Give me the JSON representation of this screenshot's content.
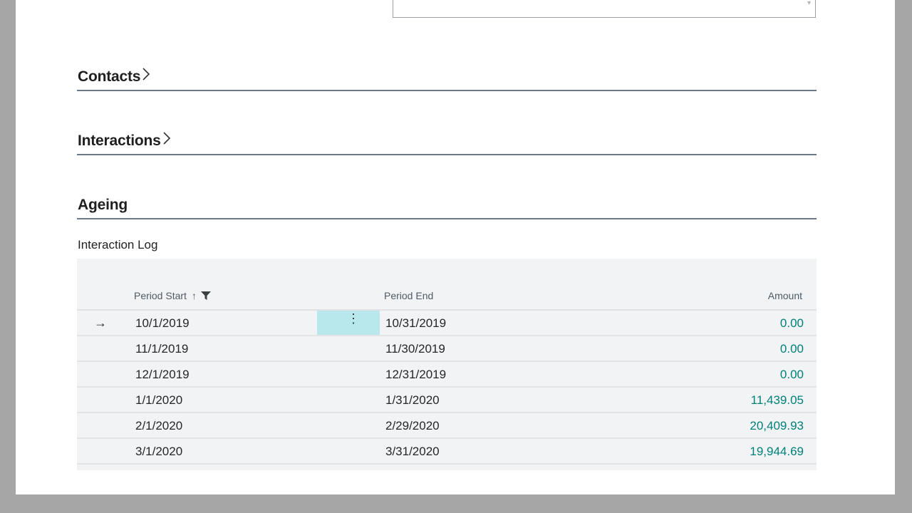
{
  "sections": [
    {
      "title": "Contacts",
      "collapsed": true
    },
    {
      "title": "Interactions",
      "collapsed": true
    },
    {
      "title": "Ageing",
      "collapsed": false
    }
  ],
  "part": {
    "title": "Interaction Log",
    "columns": {
      "period_start": "Period Start",
      "period_end": "Period End",
      "amount": "Amount"
    },
    "sort_indicator": "↑",
    "row_indicator": "→",
    "action_glyph": "⋮",
    "rows": [
      {
        "start": "10/1/2019",
        "end": "10/31/2019",
        "amount": "0.00"
      },
      {
        "start": "11/1/2019",
        "end": "11/30/2019",
        "amount": "0.00"
      },
      {
        "start": "12/1/2019",
        "end": "12/31/2019",
        "amount": "0.00"
      },
      {
        "start": "1/1/2020",
        "end": "1/31/2020",
        "amount": "11,439.05"
      },
      {
        "start": "2/1/2020",
        "end": "2/29/2020",
        "amount": "20,409.93"
      },
      {
        "start": "3/1/2020",
        "end": "3/31/2020",
        "amount": "19,944.69"
      }
    ]
  },
  "colors": {
    "amount": "#00807a",
    "selected_cell": "#b8e8ec",
    "section_rule": "#6b7886"
  },
  "icons": [
    "chevron-right-icon",
    "filter-icon",
    "sort-ascending-icon",
    "row-arrow-icon",
    "more-options-icon"
  ]
}
